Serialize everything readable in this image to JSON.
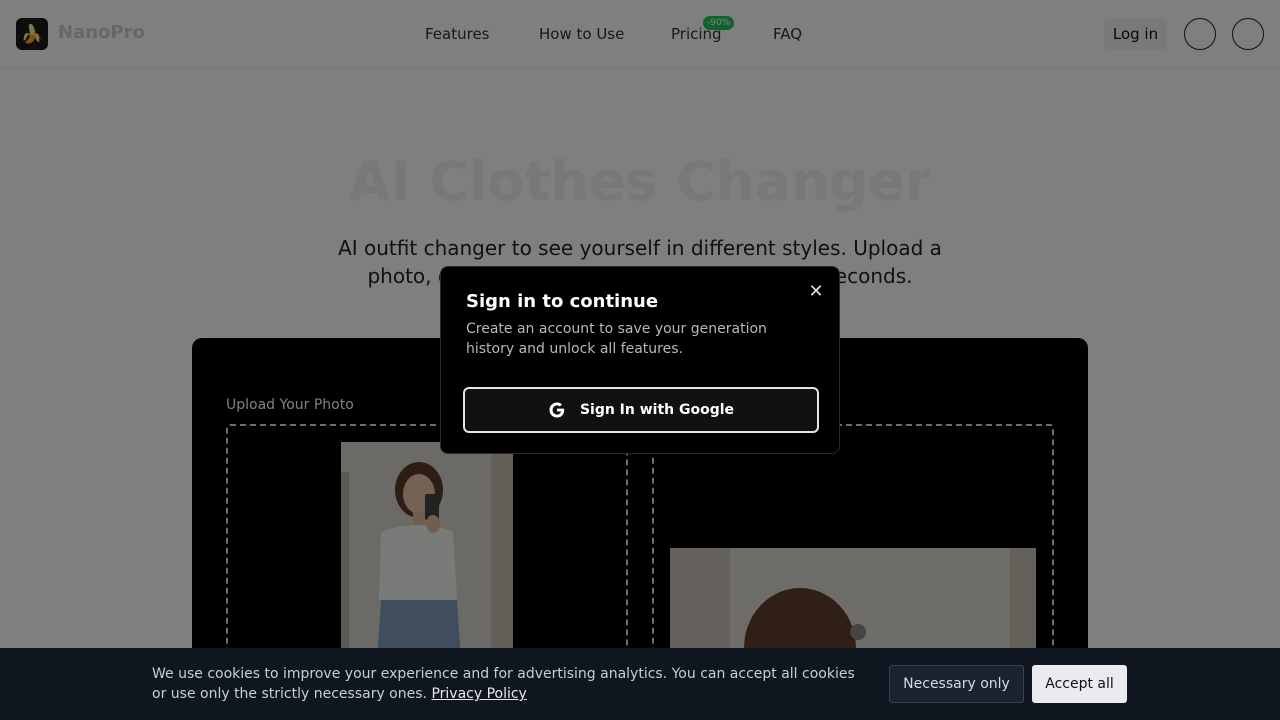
{
  "header": {
    "brand": "NanoPro",
    "nav": {
      "features": "Features",
      "how_to_use": "How to Use",
      "pricing": "Pricing",
      "pricing_badge": "-90%",
      "faq": "FAQ"
    },
    "login": "Log in"
  },
  "hero": {
    "title": "AI Clothes Changer",
    "subtitle": "AI outfit changer to see yourself in different styles. Upload a photo, choose an outfit, and see the result in seconds."
  },
  "tool": {
    "upload_label": "Upload Your Photo"
  },
  "modal": {
    "title": "Sign in to continue",
    "description": "Create an account to save your generation history and unlock all features.",
    "google_button": "Sign In with Google"
  },
  "cookie": {
    "text": "We use cookies to improve your experience and for advertising analytics. You can accept all cookies or use only the strictly necessary ones.",
    "privacy_link": "Privacy Policy",
    "necessary_only": "Necessary only",
    "accept_all": "Accept all"
  },
  "colors": {
    "overlay": "#000000",
    "badge": "#22c55e",
    "cookie_bg": "#0f1620"
  }
}
